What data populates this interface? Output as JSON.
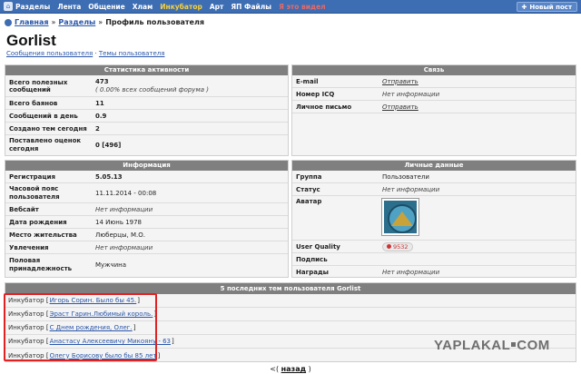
{
  "topbar": {
    "items": [
      "Разделы",
      "Лента",
      "Общение",
      "Хлам",
      "Инкубатор",
      "Арт",
      "ЯП Файлы",
      "Я это видел"
    ],
    "new_post": "Новый пост"
  },
  "breadcrumb": {
    "home": "Главная",
    "sections": "Разделы",
    "current": "Профиль пользователя",
    "sep": "»"
  },
  "profile": {
    "name": "Gorlist",
    "link_posts": "Сообщения пользователя",
    "link_sep": "·",
    "link_topics": "Темы пользователя"
  },
  "stats": {
    "title": "Статистика активности",
    "rows": [
      {
        "k": "Всего полезных сообщений",
        "v": "473",
        "v2": "( 0.00% всех сообщений форума )"
      },
      {
        "k": "Всего баянов",
        "v": "11"
      },
      {
        "k": "Сообщений в день",
        "v": "0.9"
      },
      {
        "k": "Создано тем сегодня",
        "v": "2"
      },
      {
        "k": "Поставлено оценок сегодня",
        "v": "0 [496]"
      }
    ]
  },
  "contact": {
    "title": "Связь",
    "rows": [
      {
        "k": "E-mail",
        "v": "Отправить",
        "link": true
      },
      {
        "k": "Номер ICQ",
        "v": "Нет информации",
        "link": false
      },
      {
        "k": "Личное письмо",
        "v": "Отправить",
        "link": true
      }
    ]
  },
  "info": {
    "title": "Информация",
    "rows": [
      {
        "k": "Регистрация",
        "v": "5.05.13",
        "style": "b"
      },
      {
        "k": "Часовой пояс пользователя",
        "v": "11.11.2014 - 00:08",
        "style": ""
      },
      {
        "k": "Вебсайт",
        "v": "Нет информации",
        "style": "i"
      },
      {
        "k": "Дата рождения",
        "v": "14 Июнь 1978",
        "style": ""
      },
      {
        "k": "Место жительства",
        "v": "Люберцы, М.О.",
        "style": ""
      },
      {
        "k": "Увлечения",
        "v": "Нет информации",
        "style": "i"
      },
      {
        "k": "Половая принадлежность",
        "v": "Мужчина",
        "style": ""
      }
    ]
  },
  "personal": {
    "title": "Личные данные",
    "group_k": "Группа",
    "group_v": "Пользователи",
    "status_k": "Статус",
    "status_v": "Нет информации",
    "avatar_k": "Аватар",
    "quality_k": "User Quality",
    "quality_v": "9532",
    "signature_k": "Подпись",
    "awards_k": "Награды",
    "awards_v": "Нет информации"
  },
  "topics": {
    "title": "5 последних тем пользователя Gorlist",
    "category": "Инкубатор",
    "items": [
      "Игорь Сорин. Было бы 45.",
      "Эраст Гарин.Любимый король.",
      "С Днем рождения, Олег.",
      "Анастасу Алексеевичу Микояну - 63",
      "Олегу Борисову было бы 85 лет"
    ]
  },
  "pager": {
    "prev": "<(",
    "back": "назад",
    "close": ")"
  },
  "watermark": {
    "left": "YAPLAKAL",
    "right": "COM"
  }
}
